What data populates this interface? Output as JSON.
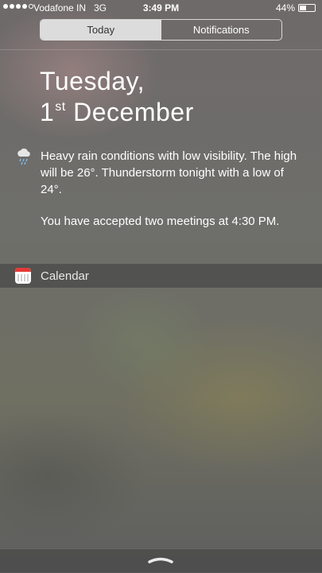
{
  "status_bar": {
    "carrier": "Vodafone IN",
    "network": "3G",
    "time": "3:49 PM",
    "battery_percent": "44%",
    "battery_level": 0.44,
    "signal_bars": 4,
    "signal_total": 5
  },
  "segments": {
    "today_label": "Today",
    "notifications_label": "Notifications",
    "selected": "Today"
  },
  "date": {
    "weekday": "Tuesday,",
    "day_number": "1",
    "day_suffix": "st",
    "month": "December"
  },
  "summary": {
    "weather_icon": "rain-cloud-icon",
    "weather_text": "Heavy rain conditions with low visibility. The high will be 26°. Thunderstorm tonight with a low of 24°.",
    "meetings_text": "You have accepted two meetings at 4:30 PM."
  },
  "widgets": {
    "calendar_icon": "calendar-icon",
    "calendar_label": "Calendar"
  },
  "colors": {
    "calendar_accent": "#e53935",
    "segment_active_bg": "#dcdcdc"
  }
}
